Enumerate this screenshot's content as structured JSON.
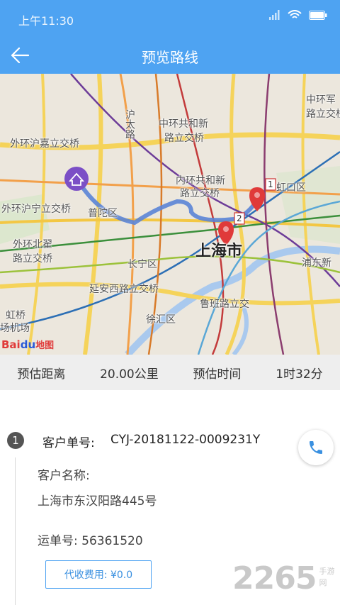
{
  "status_bar": {
    "time": "上午11:30",
    "signal_icon": "signal-icon",
    "wifi_icon": "wifi-icon",
    "battery_icon": "battery-icon"
  },
  "header": {
    "title": "预览路线",
    "back_icon": "back-arrow-icon"
  },
  "map": {
    "labels": {
      "jiading": "外环沪嘉立交桥",
      "huning": "外环沪宁立交桥",
      "beizhai": "外环北翟",
      "beizhai2": "路立交桥",
      "putuo": "普陀区",
      "hutai": "沪太路",
      "zhonghuan_gonghexin1": "中环共和新",
      "zhonghuan_gonghexin2": "路立交桥",
      "neihuan_gonghexin1": "内环共和新",
      "neihuan_gonghexin2": "路立交桥",
      "zhonghuan_jun1": "中环军",
      "zhonghuan_jun2": "路立交桥",
      "hongkou": "虹口区",
      "shanghai": "上海市",
      "changning": "长宁区",
      "yanan": "延安西路立交桥",
      "pudong": "浦东新",
      "luban": "鲁班路立交",
      "xuhui": "徐汇区",
      "hongqiao1": "虹桥",
      "hongqiao2": "场机场"
    },
    "markers": [
      "1",
      "2"
    ],
    "logo": "Bai地图",
    "route_color": "#5b84d6",
    "start_icon": "warehouse-pin-icon",
    "destination_icon": "map-pin-icon"
  },
  "summary": {
    "distance_label": "预估距离",
    "distance_value": "20.00公里",
    "time_label": "预估时间",
    "time_value": "1时32分"
  },
  "detail": {
    "step_number": "1",
    "order_label": "客户单号:",
    "order_value": "CYJ-20181122-0009231Y",
    "customer_label": "客户名称:",
    "address": "上海市东汉阳路445号",
    "waybill": "运单号:  56361520",
    "fee_button": "代收费用: ¥0.0",
    "phone_icon": "phone-icon"
  },
  "watermark": {
    "number": "2265",
    "sub": "手游网"
  },
  "colors": {
    "primary": "#4ea3f2",
    "summary_bg": "#eeeeee"
  }
}
